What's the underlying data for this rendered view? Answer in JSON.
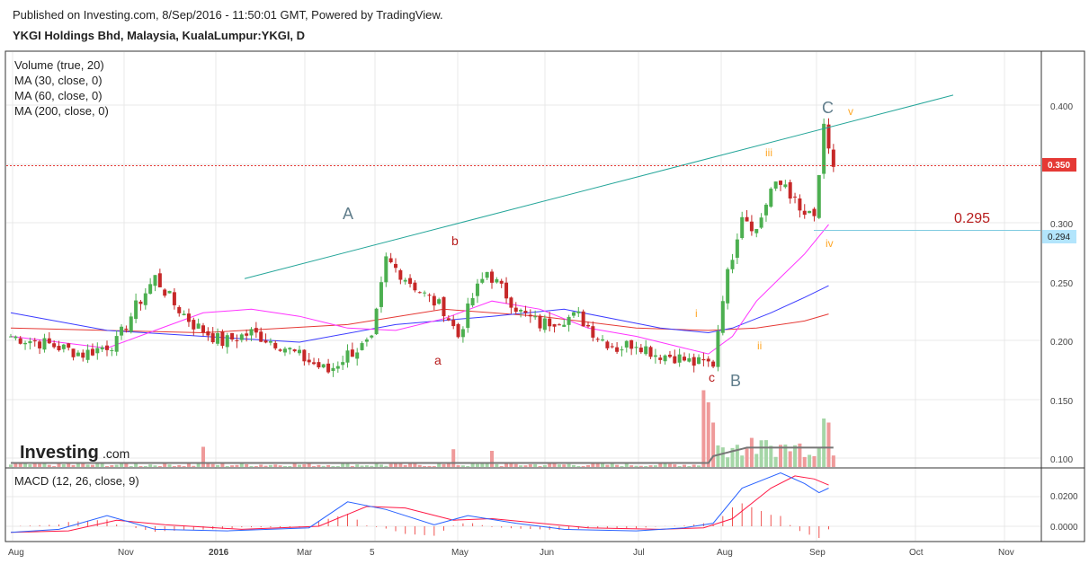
{
  "header": {
    "published": "Published on Investing.com, 8/Sep/2016 - 11:50:01 GMT, Powered by TradingView.",
    "title": "YKGI Holdings Bhd, Malaysia, KualaLumpur:YKGI, D"
  },
  "logo": {
    "bold": "Investing",
    "suffix": ".com"
  },
  "indicators": [
    "Volume (true, 20)",
    "MA (30, close, 0)",
    "MA (60, close, 0)",
    "MA (200, close, 0)"
  ],
  "macd_label": "MACD (12, 26, close, 9)",
  "colors": {
    "up": "#4caf50",
    "down": "#c62828",
    "ma30": "#ff33ff",
    "ma60": "#3b3bff",
    "ma200": "#e53935",
    "trend": "#26a69a",
    "price_line": "#e53935",
    "fib_line": "#80cbe0",
    "macd": "#2962ff",
    "signal": "#ff1744",
    "wave_letter": "#607d8b",
    "wave_small": "#b71c1c",
    "wave_minor": "#ffa726"
  },
  "chart_data": {
    "type": "candlestick",
    "symbol": "YKGI",
    "price_axis": {
      "min": 0.1,
      "max": 0.4,
      "ticks": [
        "0.100",
        "0.150",
        "0.200",
        "0.250",
        "0.300",
        "0.350",
        "0.400"
      ]
    },
    "macd_axis": {
      "ticks": [
        "0.0200",
        "0.0000"
      ]
    },
    "x_labels": [
      "Aug",
      "Nov",
      "2016",
      "Mar",
      "5",
      "May",
      "Jun",
      "Jul",
      "Aug",
      "Sep",
      "Oct",
      "Nov"
    ],
    "current_price": {
      "value": 0.35,
      "label": "0.350"
    },
    "fib_level": {
      "value": 0.294,
      "label": "0.294",
      "annotation": "0.295"
    },
    "wave_labels": {
      "major": [
        "A",
        "B",
        "C"
      ],
      "minor": [
        "a",
        "b",
        "c"
      ],
      "sub": [
        "i",
        "ii",
        "iii",
        "iv",
        "v"
      ]
    },
    "anchors": [
      {
        "i": 0,
        "p": 0.205
      },
      {
        "i": 8,
        "p": 0.198
      },
      {
        "i": 15,
        "p": 0.19
      },
      {
        "i": 22,
        "p": 0.2
      },
      {
        "i": 26,
        "p": 0.23
      },
      {
        "i": 30,
        "p": 0.255
      },
      {
        "i": 34,
        "p": 0.232
      },
      {
        "i": 38,
        "p": 0.215
      },
      {
        "i": 44,
        "p": 0.2
      },
      {
        "i": 50,
        "p": 0.208
      },
      {
        "i": 56,
        "p": 0.198
      },
      {
        "i": 60,
        "p": 0.188
      },
      {
        "i": 66,
        "p": 0.175
      },
      {
        "i": 70,
        "p": 0.19
      },
      {
        "i": 75,
        "p": 0.2
      },
      {
        "i": 78,
        "p": 0.27
      },
      {
        "i": 82,
        "p": 0.255
      },
      {
        "i": 86,
        "p": 0.24
      },
      {
        "i": 90,
        "p": 0.228
      },
      {
        "i": 93,
        "p": 0.205
      },
      {
        "i": 96,
        "p": 0.238
      },
      {
        "i": 99,
        "p": 0.26
      },
      {
        "i": 102,
        "p": 0.245
      },
      {
        "i": 106,
        "p": 0.225
      },
      {
        "i": 110,
        "p": 0.215
      },
      {
        "i": 114,
        "p": 0.22
      },
      {
        "i": 118,
        "p": 0.222
      },
      {
        "i": 122,
        "p": 0.205
      },
      {
        "i": 126,
        "p": 0.195
      },
      {
        "i": 130,
        "p": 0.2
      },
      {
        "i": 134,
        "p": 0.19
      },
      {
        "i": 138,
        "p": 0.188
      },
      {
        "i": 142,
        "p": 0.182
      },
      {
        "i": 146,
        "p": 0.182
      },
      {
        "i": 148,
        "p": 0.24
      },
      {
        "i": 150,
        "p": 0.275
      },
      {
        "i": 152,
        "p": 0.31
      },
      {
        "i": 155,
        "p": 0.295
      },
      {
        "i": 158,
        "p": 0.33
      },
      {
        "i": 161,
        "p": 0.335
      },
      {
        "i": 164,
        "p": 0.31
      },
      {
        "i": 167,
        "p": 0.305
      },
      {
        "i": 169,
        "p": 0.38
      },
      {
        "i": 170,
        "p": 0.36
      },
      {
        "i": 171,
        "p": 0.35
      }
    ],
    "ma30": [
      [
        0,
        0.205
      ],
      [
        20,
        0.195
      ],
      [
        30,
        0.21
      ],
      [
        40,
        0.225
      ],
      [
        50,
        0.228
      ],
      [
        60,
        0.222
      ],
      [
        70,
        0.212
      ],
      [
        80,
        0.21
      ],
      [
        90,
        0.22
      ],
      [
        100,
        0.235
      ],
      [
        110,
        0.228
      ],
      [
        120,
        0.212
      ],
      [
        130,
        0.205
      ],
      [
        140,
        0.195
      ],
      [
        145,
        0.19
      ],
      [
        150,
        0.205
      ],
      [
        155,
        0.235
      ],
      [
        160,
        0.255
      ],
      [
        165,
        0.275
      ],
      [
        170,
        0.3
      ]
    ],
    "ma60": [
      [
        0,
        0.225
      ],
      [
        20,
        0.21
      ],
      [
        40,
        0.205
      ],
      [
        60,
        0.2
      ],
      [
        80,
        0.215
      ],
      [
        100,
        0.222
      ],
      [
        115,
        0.228
      ],
      [
        125,
        0.22
      ],
      [
        135,
        0.212
      ],
      [
        145,
        0.208
      ],
      [
        150,
        0.212
      ],
      [
        158,
        0.225
      ],
      [
        165,
        0.238
      ],
      [
        170,
        0.248
      ]
    ],
    "ma200": [
      [
        0,
        0.212
      ],
      [
        40,
        0.208
      ],
      [
        70,
        0.215
      ],
      [
        90,
        0.228
      ],
      [
        110,
        0.222
      ],
      [
        130,
        0.212
      ],
      [
        145,
        0.21
      ],
      [
        155,
        0.212
      ],
      [
        165,
        0.218
      ],
      [
        170,
        0.224
      ]
    ],
    "trendline": [
      [
        0.2535,
        0.0
      ],
      [
        1.0,
        0.41
      ]
    ],
    "volume_spikes": [
      [
        144,
        0.95
      ],
      [
        145,
        0.8
      ],
      [
        146,
        0.55
      ],
      [
        169,
        0.6
      ],
      [
        170,
        0.55
      ],
      [
        40,
        0.25
      ],
      [
        92,
        0.22
      ],
      [
        100,
        0.2
      ]
    ],
    "macd": [
      [
        0,
        -0.004
      ],
      [
        10,
        -0.002
      ],
      [
        20,
        0.007
      ],
      [
        30,
        -0.002
      ],
      [
        45,
        -0.003
      ],
      [
        62,
        -0.001
      ],
      [
        70,
        0.016
      ],
      [
        78,
        0.011
      ],
      [
        88,
        0.001
      ],
      [
        95,
        0.007
      ],
      [
        105,
        0.002
      ],
      [
        115,
        -0.002
      ],
      [
        130,
        -0.003
      ],
      [
        140,
        -0.001
      ],
      [
        146,
        0.002
      ],
      [
        152,
        0.025
      ],
      [
        160,
        0.035
      ],
      [
        165,
        0.028
      ],
      [
        168,
        0.022
      ],
      [
        170,
        0.025
      ]
    ],
    "signal": [
      [
        0,
        -0.004
      ],
      [
        12,
        -0.003
      ],
      [
        22,
        0.004
      ],
      [
        32,
        0.001
      ],
      [
        48,
        -0.002
      ],
      [
        64,
        0.0
      ],
      [
        74,
        0.013
      ],
      [
        82,
        0.012
      ],
      [
        92,
        0.004
      ],
      [
        100,
        0.005
      ],
      [
        110,
        0.002
      ],
      [
        120,
        -0.001
      ],
      [
        135,
        -0.002
      ],
      [
        144,
        -0.001
      ],
      [
        150,
        0.005
      ],
      [
        158,
        0.025
      ],
      [
        163,
        0.033
      ],
      [
        167,
        0.031
      ],
      [
        170,
        0.027
      ]
    ]
  }
}
